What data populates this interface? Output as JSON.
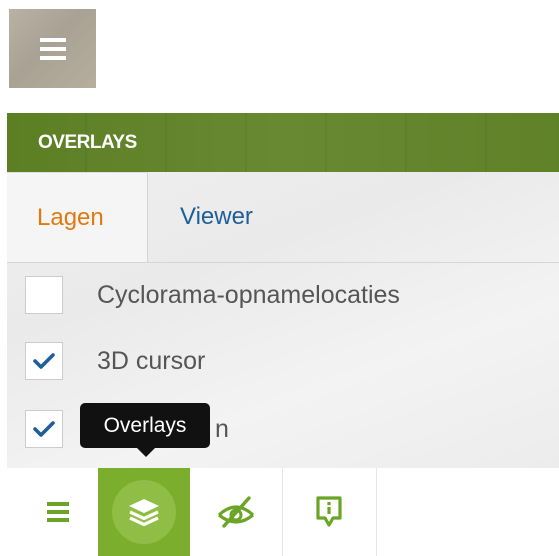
{
  "menu_button": {
    "icon": "hamburger-icon"
  },
  "panel": {
    "title": "OVERLAYS",
    "tabs": [
      {
        "label": "Lagen",
        "active": true
      },
      {
        "label": "Viewer",
        "active": false
      }
    ],
    "layers": [
      {
        "label": "Cyclorama-opnamelocaties",
        "checked": false
      },
      {
        "label": "3D cursor",
        "checked": true
      },
      {
        "label": "",
        "checked": true
      }
    ]
  },
  "toolbar": {
    "items": [
      {
        "icon": "hamburger-icon",
        "active": false
      },
      {
        "icon": "layers-icon",
        "active": true
      },
      {
        "icon": "eye-slash-icon",
        "active": false
      },
      {
        "icon": "info-marker-icon",
        "active": false
      }
    ]
  },
  "tooltip": {
    "text": "Overlays",
    "partial_text_visible_after": "n"
  },
  "colors": {
    "header_green": "#5d7f23",
    "active_tool_green": "#7cae2e",
    "icon_green": "#6aa526",
    "active_tab_orange": "#e07a10",
    "inactive_tab_blue": "#1d5f96",
    "checkmark_blue": "#1d5f96"
  }
}
